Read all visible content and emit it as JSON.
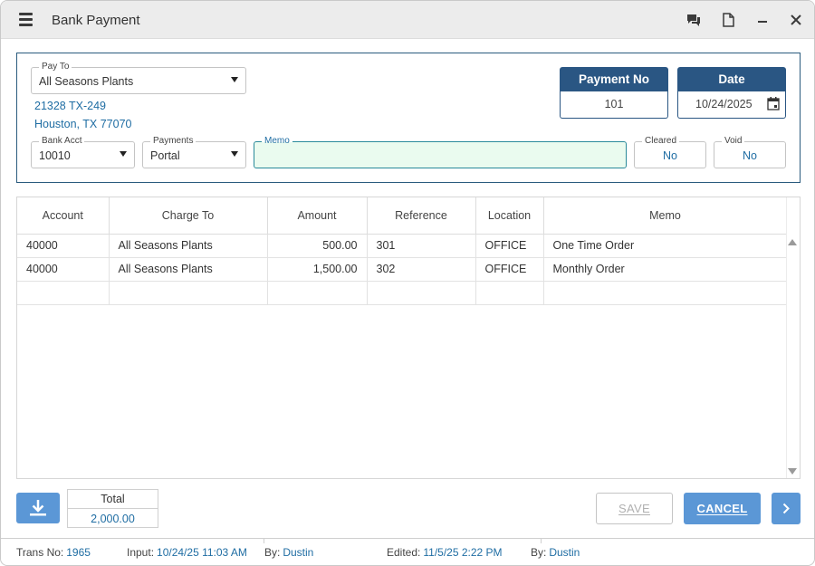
{
  "window": {
    "title": "Bank Payment",
    "icons": [
      "menu-icon",
      "chat-icon",
      "document-icon",
      "minimize-icon",
      "close-icon"
    ]
  },
  "header": {
    "pay_to": {
      "label": "Pay To",
      "value": "All Seasons Plants"
    },
    "address_line1": "21328 TX-249",
    "address_line2": "Houston, TX 77070",
    "bank_acct": {
      "label": "Bank Acct",
      "value": "10010"
    },
    "payments": {
      "label": "Payments",
      "value": "Portal"
    },
    "memo": {
      "label": "Memo",
      "value": ""
    },
    "cleared": {
      "label": "Cleared",
      "value": "No"
    },
    "void": {
      "label": "Void",
      "value": "No"
    },
    "payment_no": {
      "label": "Payment No",
      "value": "101"
    },
    "date": {
      "label": "Date",
      "value": "10/24/2025"
    }
  },
  "grid": {
    "columns": [
      "Account",
      "Charge To",
      "Amount",
      "Reference",
      "Location",
      "Memo"
    ],
    "rows": [
      [
        "40000",
        "All Seasons Plants",
        "500.00",
        "301",
        "OFFICE",
        "One Time Order"
      ],
      [
        "40000",
        "All Seasons Plants",
        "1,500.00",
        "302",
        "OFFICE",
        "Monthly Order"
      ],
      [
        "",
        "",
        "",
        "",
        "",
        ""
      ]
    ]
  },
  "totals": {
    "label": "Total",
    "value": "2,000.00"
  },
  "actions": {
    "save_label": "SAVE",
    "cancel_label": "CANCEL"
  },
  "footer": {
    "trans_no_label": "Trans No:",
    "trans_no": "1965",
    "input_label": "Input:",
    "input_value": "10/24/25 11:03 AM",
    "input_by_label": "By:",
    "input_by": "Dustin",
    "edited_label": "Edited:",
    "edited_value": "11/5/25 2:22 PM",
    "edited_by_label": "By:",
    "edited_by": "Dustin"
  },
  "colors": {
    "accent": "#5b97d6",
    "header_navy": "#2a5683",
    "link_blue": "#1f6da3",
    "memo_bg": "#eafbef"
  }
}
